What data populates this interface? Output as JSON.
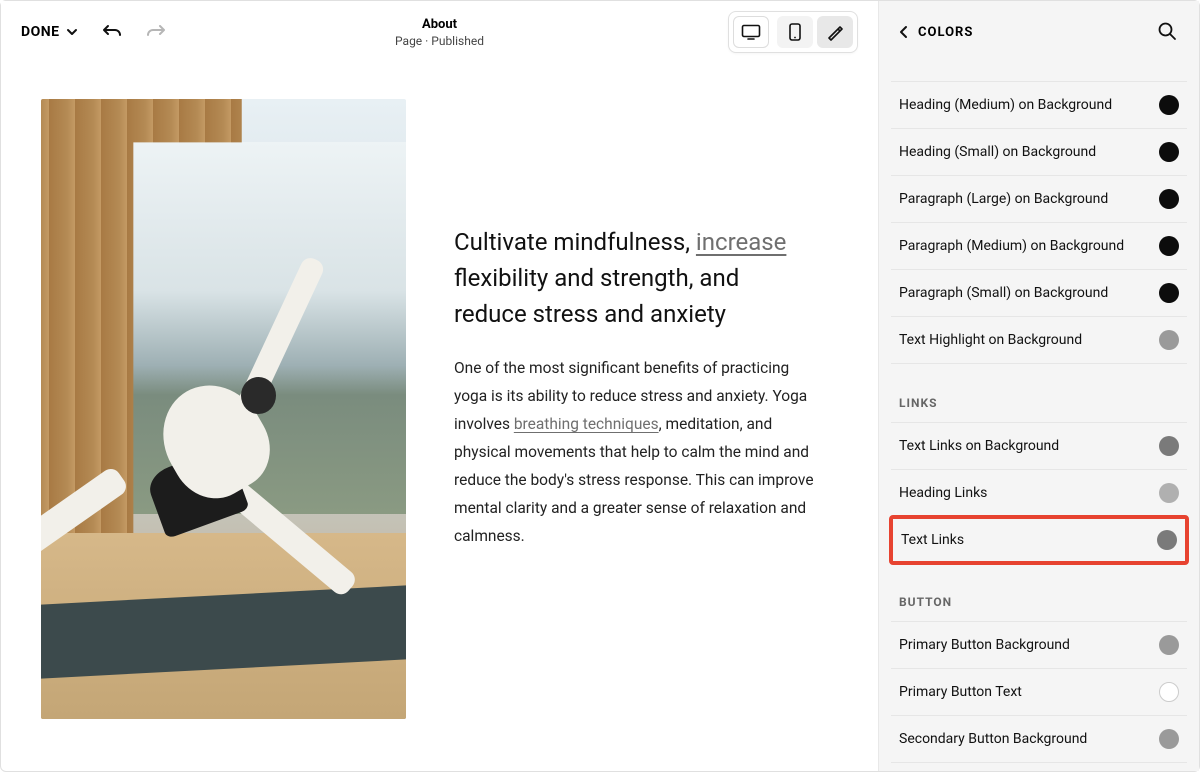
{
  "topbar": {
    "done_label": "DONE",
    "page_title": "About",
    "page_subtitle": "Page · Published"
  },
  "content": {
    "headline_before": "Cultivate mindfulness, ",
    "headline_link": "increase",
    "headline_after": " flexibility and strength, and reduce stress and anxiety",
    "body_before": "One of the most significant benefits of practicing yoga is its ability to reduce stress and anxiety. Yoga involves ",
    "body_link": "breathing techniques",
    "body_after": ", meditation, and physical movements that help to calm the mind and reduce the body's stress response. This can improve mental clarity and a greater sense of relaxation and calmness."
  },
  "sidebar": {
    "panel_title": "COLORS",
    "sections": {
      "text": [
        {
          "label": "Heading (Medium) on Background",
          "color": "#0c0c0c"
        },
        {
          "label": "Heading (Small) on Background",
          "color": "#0c0c0c"
        },
        {
          "label": "Paragraph (Large) on Background",
          "color": "#0c0c0c"
        },
        {
          "label": "Paragraph (Medium) on Background",
          "color": "#0c0c0c"
        },
        {
          "label": "Paragraph (Small) on Background",
          "color": "#0c0c0c"
        },
        {
          "label": "Text Highlight on Background",
          "color": "#9a9a9a"
        }
      ],
      "links_label": "LINKS",
      "links": [
        {
          "label": "Text Links on Background",
          "color": "#7a7a7a"
        },
        {
          "label": "Heading Links",
          "color": "#b0b0b0"
        },
        {
          "label": "Text Links",
          "color": "#7a7a7a",
          "highlighted": true
        }
      ],
      "button_label": "BUTTON",
      "button": [
        {
          "label": "Primary Button Background",
          "color": "#9a9a9a"
        },
        {
          "label": "Primary Button Text",
          "color": "#ffffff",
          "white": true
        },
        {
          "label": "Secondary Button Background",
          "color": "#9a9a9a"
        }
      ]
    }
  }
}
